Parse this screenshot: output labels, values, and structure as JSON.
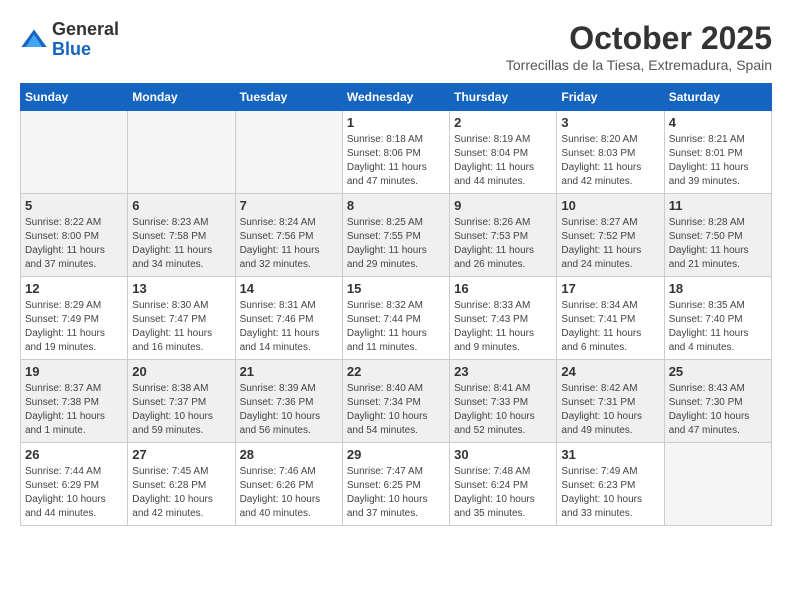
{
  "header": {
    "logo_line1": "General",
    "logo_line2": "Blue",
    "month": "October 2025",
    "location": "Torrecillas de la Tiesa, Extremadura, Spain"
  },
  "weekdays": [
    "Sunday",
    "Monday",
    "Tuesday",
    "Wednesday",
    "Thursday",
    "Friday",
    "Saturday"
  ],
  "weeks": [
    [
      {
        "day": "",
        "info": ""
      },
      {
        "day": "",
        "info": ""
      },
      {
        "day": "",
        "info": ""
      },
      {
        "day": "1",
        "info": "Sunrise: 8:18 AM\nSunset: 8:06 PM\nDaylight: 11 hours and 47 minutes."
      },
      {
        "day": "2",
        "info": "Sunrise: 8:19 AM\nSunset: 8:04 PM\nDaylight: 11 hours and 44 minutes."
      },
      {
        "day": "3",
        "info": "Sunrise: 8:20 AM\nSunset: 8:03 PM\nDaylight: 11 hours and 42 minutes."
      },
      {
        "day": "4",
        "info": "Sunrise: 8:21 AM\nSunset: 8:01 PM\nDaylight: 11 hours and 39 minutes."
      }
    ],
    [
      {
        "day": "5",
        "info": "Sunrise: 8:22 AM\nSunset: 8:00 PM\nDaylight: 11 hours and 37 minutes."
      },
      {
        "day": "6",
        "info": "Sunrise: 8:23 AM\nSunset: 7:58 PM\nDaylight: 11 hours and 34 minutes."
      },
      {
        "day": "7",
        "info": "Sunrise: 8:24 AM\nSunset: 7:56 PM\nDaylight: 11 hours and 32 minutes."
      },
      {
        "day": "8",
        "info": "Sunrise: 8:25 AM\nSunset: 7:55 PM\nDaylight: 11 hours and 29 minutes."
      },
      {
        "day": "9",
        "info": "Sunrise: 8:26 AM\nSunset: 7:53 PM\nDaylight: 11 hours and 26 minutes."
      },
      {
        "day": "10",
        "info": "Sunrise: 8:27 AM\nSunset: 7:52 PM\nDaylight: 11 hours and 24 minutes."
      },
      {
        "day": "11",
        "info": "Sunrise: 8:28 AM\nSunset: 7:50 PM\nDaylight: 11 hours and 21 minutes."
      }
    ],
    [
      {
        "day": "12",
        "info": "Sunrise: 8:29 AM\nSunset: 7:49 PM\nDaylight: 11 hours and 19 minutes."
      },
      {
        "day": "13",
        "info": "Sunrise: 8:30 AM\nSunset: 7:47 PM\nDaylight: 11 hours and 16 minutes."
      },
      {
        "day": "14",
        "info": "Sunrise: 8:31 AM\nSunset: 7:46 PM\nDaylight: 11 hours and 14 minutes."
      },
      {
        "day": "15",
        "info": "Sunrise: 8:32 AM\nSunset: 7:44 PM\nDaylight: 11 hours and 11 minutes."
      },
      {
        "day": "16",
        "info": "Sunrise: 8:33 AM\nSunset: 7:43 PM\nDaylight: 11 hours and 9 minutes."
      },
      {
        "day": "17",
        "info": "Sunrise: 8:34 AM\nSunset: 7:41 PM\nDaylight: 11 hours and 6 minutes."
      },
      {
        "day": "18",
        "info": "Sunrise: 8:35 AM\nSunset: 7:40 PM\nDaylight: 11 hours and 4 minutes."
      }
    ],
    [
      {
        "day": "19",
        "info": "Sunrise: 8:37 AM\nSunset: 7:38 PM\nDaylight: 11 hours and 1 minute."
      },
      {
        "day": "20",
        "info": "Sunrise: 8:38 AM\nSunset: 7:37 PM\nDaylight: 10 hours and 59 minutes."
      },
      {
        "day": "21",
        "info": "Sunrise: 8:39 AM\nSunset: 7:36 PM\nDaylight: 10 hours and 56 minutes."
      },
      {
        "day": "22",
        "info": "Sunrise: 8:40 AM\nSunset: 7:34 PM\nDaylight: 10 hours and 54 minutes."
      },
      {
        "day": "23",
        "info": "Sunrise: 8:41 AM\nSunset: 7:33 PM\nDaylight: 10 hours and 52 minutes."
      },
      {
        "day": "24",
        "info": "Sunrise: 8:42 AM\nSunset: 7:31 PM\nDaylight: 10 hours and 49 minutes."
      },
      {
        "day": "25",
        "info": "Sunrise: 8:43 AM\nSunset: 7:30 PM\nDaylight: 10 hours and 47 minutes."
      }
    ],
    [
      {
        "day": "26",
        "info": "Sunrise: 7:44 AM\nSunset: 6:29 PM\nDaylight: 10 hours and 44 minutes."
      },
      {
        "day": "27",
        "info": "Sunrise: 7:45 AM\nSunset: 6:28 PM\nDaylight: 10 hours and 42 minutes."
      },
      {
        "day": "28",
        "info": "Sunrise: 7:46 AM\nSunset: 6:26 PM\nDaylight: 10 hours and 40 minutes."
      },
      {
        "day": "29",
        "info": "Sunrise: 7:47 AM\nSunset: 6:25 PM\nDaylight: 10 hours and 37 minutes."
      },
      {
        "day": "30",
        "info": "Sunrise: 7:48 AM\nSunset: 6:24 PM\nDaylight: 10 hours and 35 minutes."
      },
      {
        "day": "31",
        "info": "Sunrise: 7:49 AM\nSunset: 6:23 PM\nDaylight: 10 hours and 33 minutes."
      },
      {
        "day": "",
        "info": ""
      }
    ]
  ]
}
